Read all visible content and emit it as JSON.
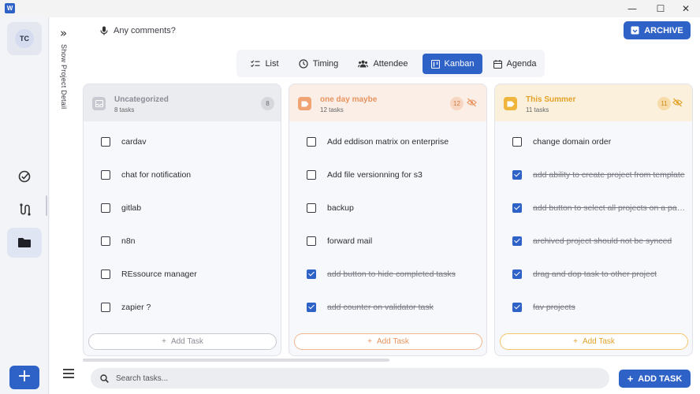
{
  "window": {
    "app_icon_letter": "W",
    "controls": {
      "minimize": "—",
      "maximize": "☐",
      "close": "✕"
    }
  },
  "rail": {
    "avatar_initials": "TC"
  },
  "strip": {
    "label": "Show Project Detail"
  },
  "header": {
    "comments_label": "Any comments?",
    "archive_label": "ARCHIVE"
  },
  "tabs": [
    {
      "label": "List"
    },
    {
      "label": "Timing"
    },
    {
      "label": "Attendee"
    },
    {
      "label": "Kanban"
    },
    {
      "label": "Agenda"
    }
  ],
  "columns": [
    {
      "title": "Uncategorized",
      "subtitle": "8 tasks",
      "count": "8",
      "accent": "#8c8c96",
      "add_label": "Add Task",
      "tasks": [
        {
          "text": "cardav",
          "done": false
        },
        {
          "text": "chat for notification",
          "done": false
        },
        {
          "text": "gitlab",
          "done": false
        },
        {
          "text": "n8n",
          "done": false
        },
        {
          "text": "REssource manager",
          "done": false
        },
        {
          "text": "zapier ?",
          "done": false
        }
      ]
    },
    {
      "title": "one day maybe",
      "subtitle": "12 tasks",
      "count": "12",
      "accent": "#f0a373",
      "add_label": "Add Task",
      "tasks": [
        {
          "text": "Add eddison matrix on enterprise",
          "done": false
        },
        {
          "text": "Add file versionning for s3",
          "done": false
        },
        {
          "text": "backup",
          "done": false
        },
        {
          "text": "forward mail",
          "done": false
        },
        {
          "text": "add button to hide completed tasks",
          "done": true
        },
        {
          "text": "add counter on validator task",
          "done": true
        }
      ]
    },
    {
      "title": "This Summer",
      "subtitle": "11 tasks",
      "count": "11",
      "accent": "#f0b53c",
      "add_label": "Add Task",
      "tasks": [
        {
          "text": "change domain order",
          "done": false
        },
        {
          "text": "add ability to create project from template",
          "done": true
        },
        {
          "text": "add button to select all projects on a page",
          "done": true
        },
        {
          "text": "archived project should not be synced",
          "done": true
        },
        {
          "text": "drag and dop task to other project",
          "done": true
        },
        {
          "text": "fav projects",
          "done": true
        }
      ]
    }
  ],
  "footer": {
    "search_placeholder": "Search tasks...",
    "add_task_label": "ADD TASK"
  },
  "colors": {
    "primary": "#2f62c7",
    "uncategorized_head": "#ebecf0",
    "one_day_head": "#fbeee6",
    "summer_head": "#fbf0dc"
  }
}
